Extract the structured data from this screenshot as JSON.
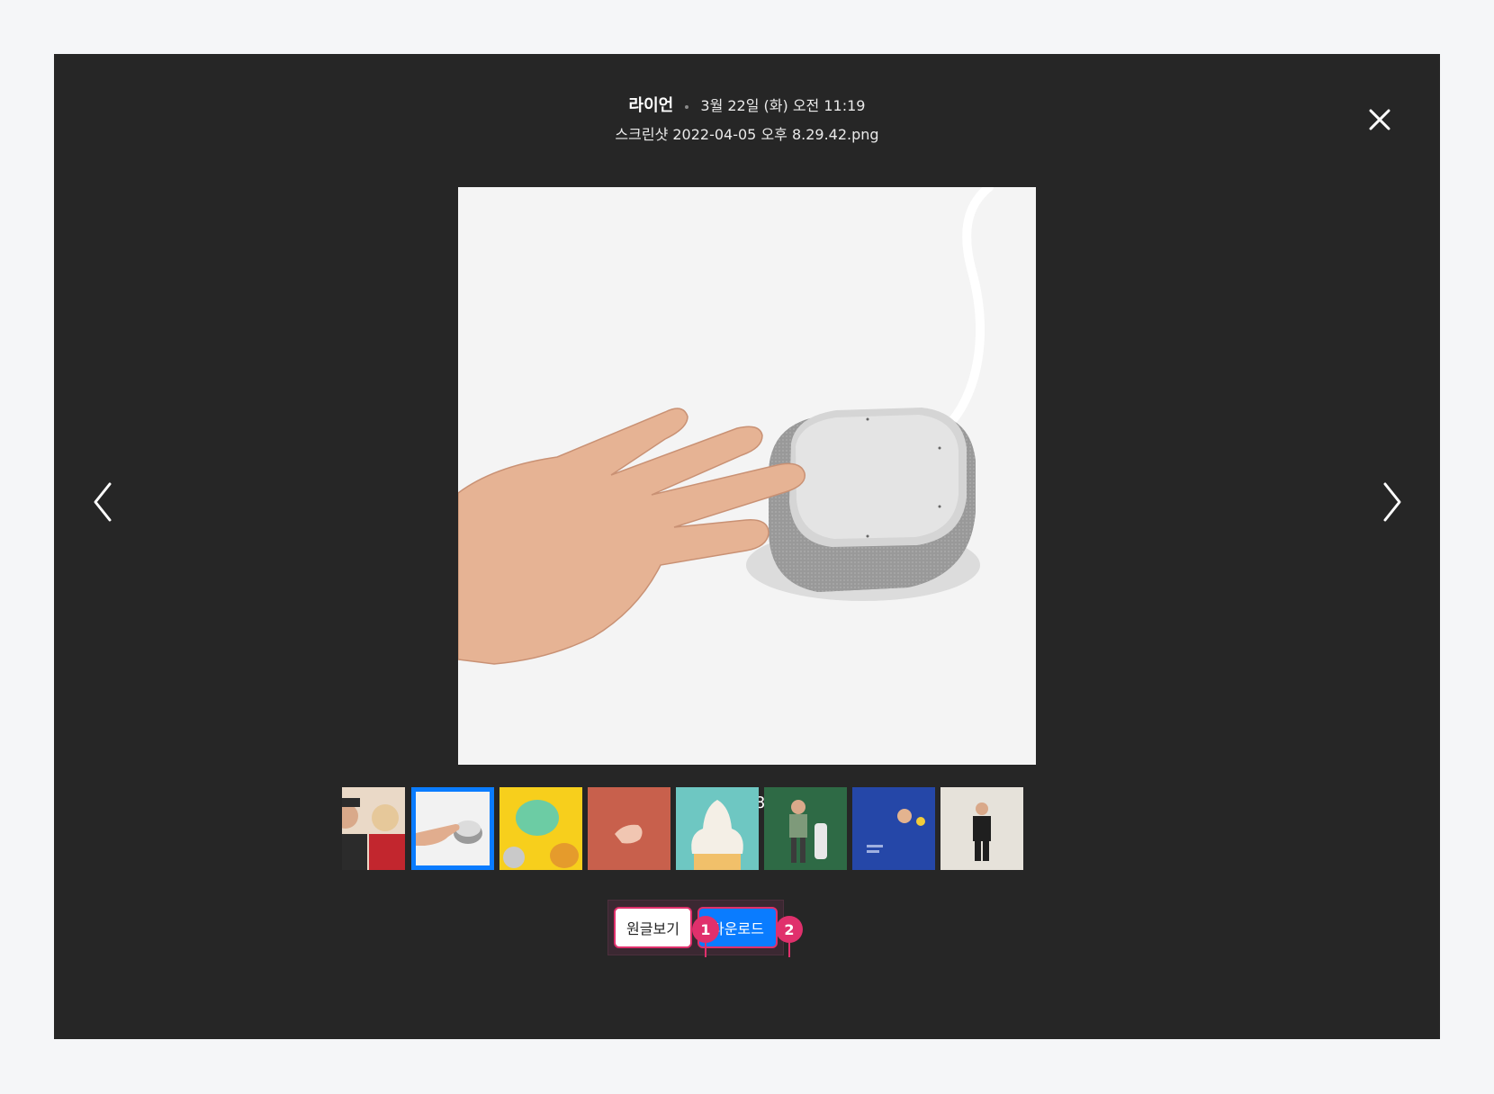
{
  "header": {
    "author": "라이언",
    "date": "3월 22일 (화) 오전 11:19",
    "filename": "스크린샷 2022-04-05 오후 8.29.42.png"
  },
  "counter": "2 / 8",
  "thumbnails": [
    {
      "name": "thumb-people"
    },
    {
      "name": "thumb-speaker",
      "selected": true
    },
    {
      "name": "thumb-green-character"
    },
    {
      "name": "thumb-hand-figure"
    },
    {
      "name": "thumb-ice-cream"
    },
    {
      "name": "thumb-golfer"
    },
    {
      "name": "thumb-blue-poster"
    },
    {
      "name": "thumb-man-suit"
    }
  ],
  "actions": {
    "original_label": "원글보기",
    "download_label": "다운로드"
  },
  "markers": {
    "one": "1",
    "two": "2"
  },
  "colors": {
    "viewer_bg": "#262626",
    "accent_blue": "#0a7cff",
    "annotation_pink": "#e0306c"
  },
  "icons": [
    "close-icon",
    "chevron-left-icon",
    "chevron-right-icon"
  ]
}
